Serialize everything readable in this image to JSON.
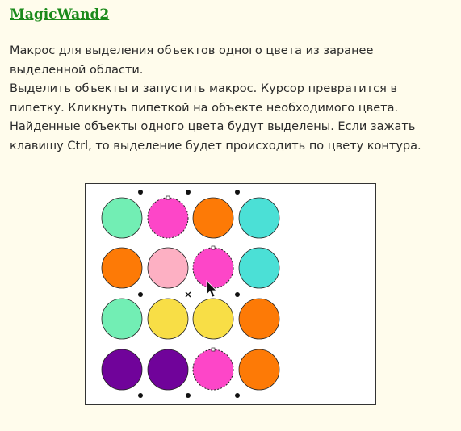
{
  "header": {
    "title": "MagicWand2"
  },
  "description": {
    "line1": "Макрос для выделения объектов одного цвета из заранее выделенной области.",
    "line2": "Выделить объекты и запустить макрос. Курсор превратится в пипетку. Кликнуть пипеткой на объекте необходимого цвета. Найденные объекты одного цвета будут выделены. Если зажать клавишу Ctrl, то выделение будет происходить по цвету контура."
  },
  "demo": {
    "grid": [
      [
        {
          "color": "#72eeb4",
          "selected": false
        },
        {
          "color": "#fd46c8",
          "selected": true
        },
        {
          "color": "#fd7a06",
          "selected": false
        },
        {
          "color": "#4be0d6",
          "selected": false
        }
      ],
      [
        {
          "color": "#fd7a06",
          "selected": false
        },
        {
          "color": "#fdb0c3",
          "selected": false
        },
        {
          "color": "#fd46c8",
          "selected": true
        },
        {
          "color": "#4be0d6",
          "selected": false
        }
      ],
      [
        {
          "color": "#72eeb4",
          "selected": false
        },
        {
          "color": "#f8de46",
          "selected": false
        },
        {
          "color": "#f8de46",
          "selected": false
        },
        {
          "color": "#fd7a06",
          "selected": false
        }
      ],
      [
        {
          "color": "#70039a",
          "selected": false
        },
        {
          "color": "#70039a",
          "selected": false
        },
        {
          "color": "#fd46c8",
          "selected": true
        },
        {
          "color": "#fd7a06",
          "selected": false
        }
      ]
    ],
    "cursor_icon": "eyedropper-cursor-icon",
    "center_marker_icon": "selection-center-x-icon"
  }
}
